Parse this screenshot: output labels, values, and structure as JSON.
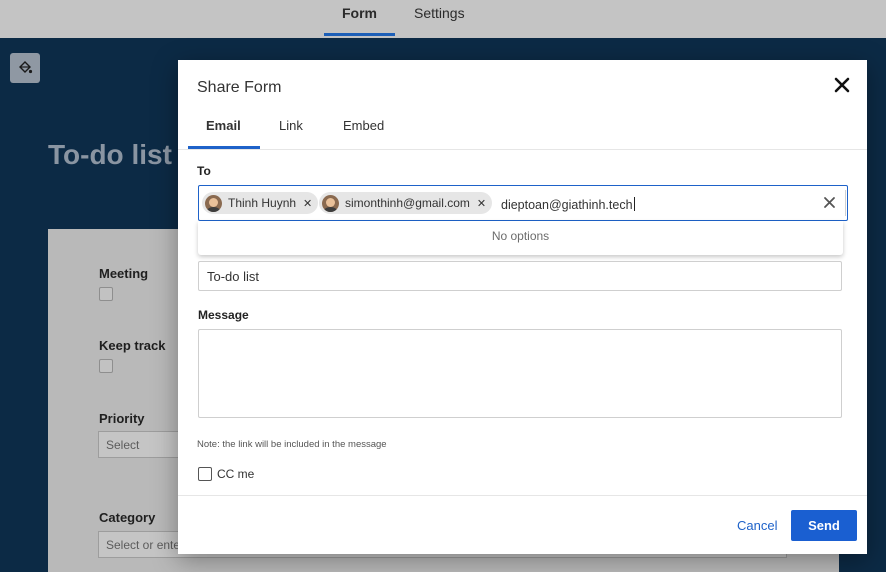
{
  "topbar": {
    "tabs": [
      {
        "label": "Form",
        "active": true
      },
      {
        "label": "Settings",
        "active": false
      }
    ]
  },
  "page": {
    "title": "To-do list",
    "fields": {
      "meeting": "Meeting",
      "keep_track": "Keep track",
      "priority": "Priority",
      "priority_placeholder": "Select",
      "category": "Category",
      "category_placeholder": "Select or ente"
    }
  },
  "dialog": {
    "title": "Share Form",
    "tabs": [
      {
        "label": "Email",
        "active": true
      },
      {
        "label": "Link",
        "active": false
      },
      {
        "label": "Embed",
        "active": false
      }
    ],
    "to": {
      "label": "To",
      "chips": [
        {
          "label": "Thinh Huynh"
        },
        {
          "label": "simonthinh@gmail.com"
        }
      ],
      "typed_value": "dieptoan@giathinh.tech",
      "dropdown_text": "No options"
    },
    "subject_value": "To-do list",
    "message": {
      "label": "Message",
      "value": ""
    },
    "note": "Note: the link will be included in the message",
    "cc_label": "CC me",
    "cc_checked": false,
    "cancel_label": "Cancel",
    "send_label": "Send"
  },
  "colors": {
    "accent": "#1e62c9",
    "send_button": "#1a5fd1",
    "canvas_bg": "#0c2a45",
    "topbar_bg": "#c4c4c4"
  }
}
